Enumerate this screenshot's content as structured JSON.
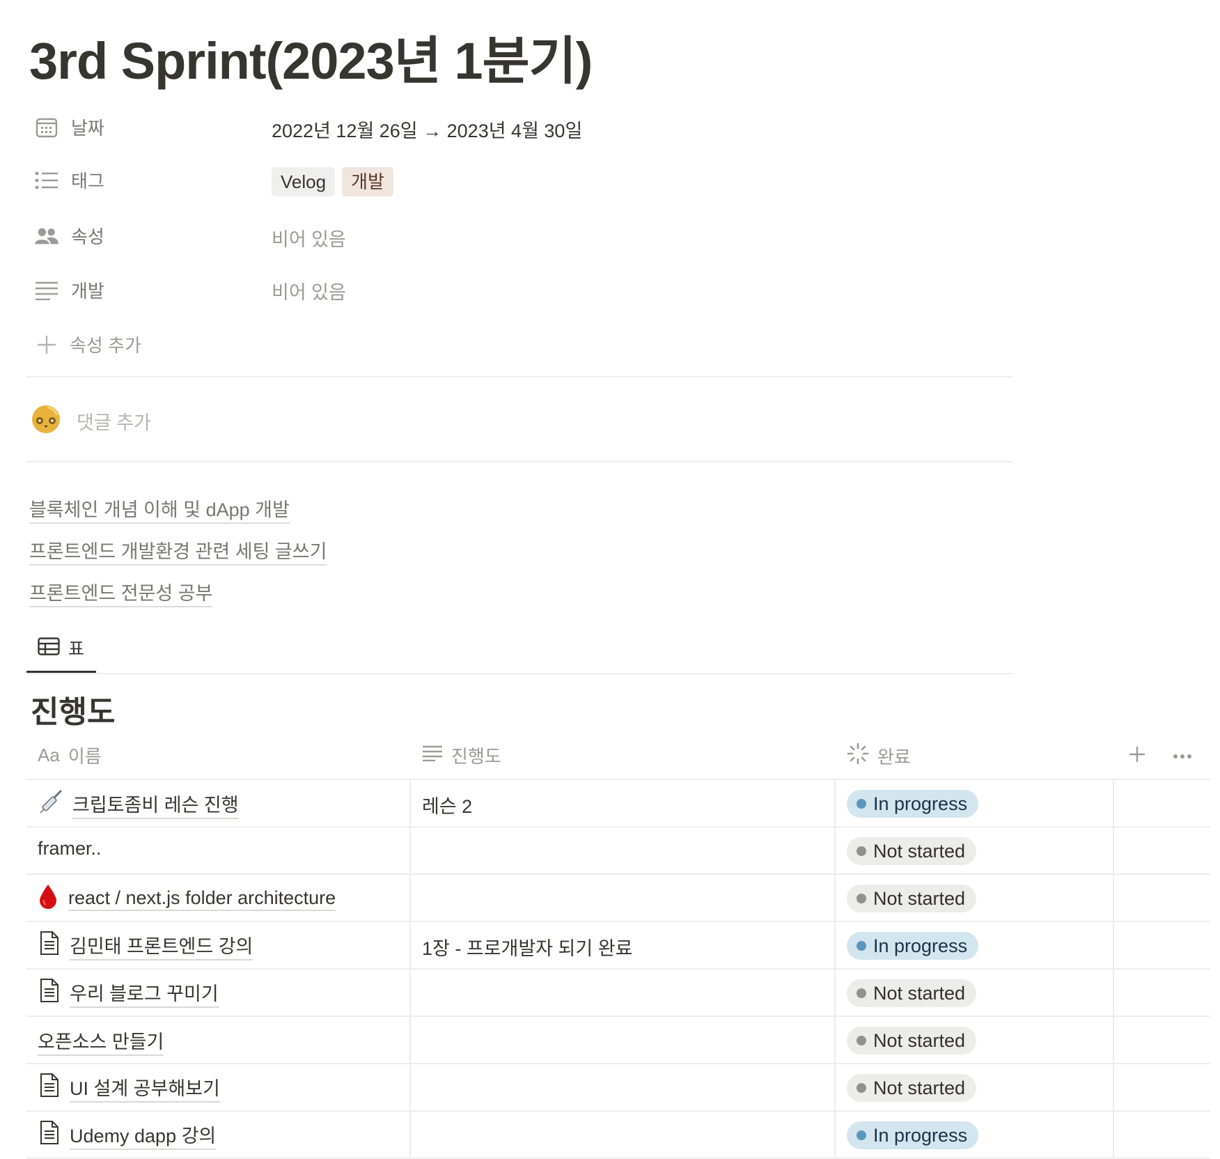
{
  "page": {
    "title": "3rd Sprint(2023년 1분기)"
  },
  "properties": [
    {
      "icon": "calendar-icon",
      "label": "날짜",
      "value": "2022년 12월 26일 → 2023년 4월 30일"
    },
    {
      "icon": "list-icon",
      "label": "태그",
      "tags": [
        "Velog",
        "개발"
      ]
    },
    {
      "icon": "people-icon",
      "label": "속성",
      "value": "비어 있음"
    },
    {
      "icon": "text-lines-icon",
      "label": "개발",
      "value": "비어 있음"
    }
  ],
  "add_property": {
    "label": "속성 추가"
  },
  "comment": {
    "placeholder": "댓글 추가"
  },
  "links": [
    "블록체인 개념 이해 및 dApp 개발",
    "프론트엔드 개발환경 관련 세팅 글쓰기",
    "프론트엔드 전문성 공부"
  ],
  "view_tab": {
    "label": "표"
  },
  "database": {
    "title": "진행도",
    "columns": {
      "name": "이름",
      "name_prefix": "Aa",
      "progress": "진행도",
      "status": "완료"
    },
    "rows": [
      {
        "icon": "syringe-icon",
        "name": "크립토좀비 레슨 진행",
        "progress": "레슨 2",
        "status": "In progress"
      },
      {
        "icon": "",
        "name": "framer..",
        "progress": "",
        "status": "Not started"
      },
      {
        "icon": "drop-icon",
        "name": "react / next.js folder architecture",
        "progress": "",
        "status": "Not started"
      },
      {
        "icon": "page-icon",
        "name": "김민태 프론트엔드 강의",
        "progress": "1장 - 프로개발자 되기 완료",
        "status": "In progress"
      },
      {
        "icon": "page-icon",
        "name": "우리 블로그 꾸미기",
        "progress": "",
        "status": "Not started"
      },
      {
        "icon": "",
        "name": "오픈소스 만들기",
        "progress": "",
        "status": "Not started"
      },
      {
        "icon": "page-icon",
        "name": "UI 설계 공부해보기",
        "progress": "",
        "status": "Not started"
      },
      {
        "icon": "page-icon",
        "name": "Udemy dapp 강의",
        "progress": "",
        "status": "In progress"
      }
    ]
  },
  "colors": {
    "in_progress_bg": "#d3e5ef",
    "in_progress_dot": "#5b97bd",
    "not_started_bg": "#ececeb",
    "not_started_dot": "#91918e",
    "tag_brown": "#f1e5df"
  }
}
